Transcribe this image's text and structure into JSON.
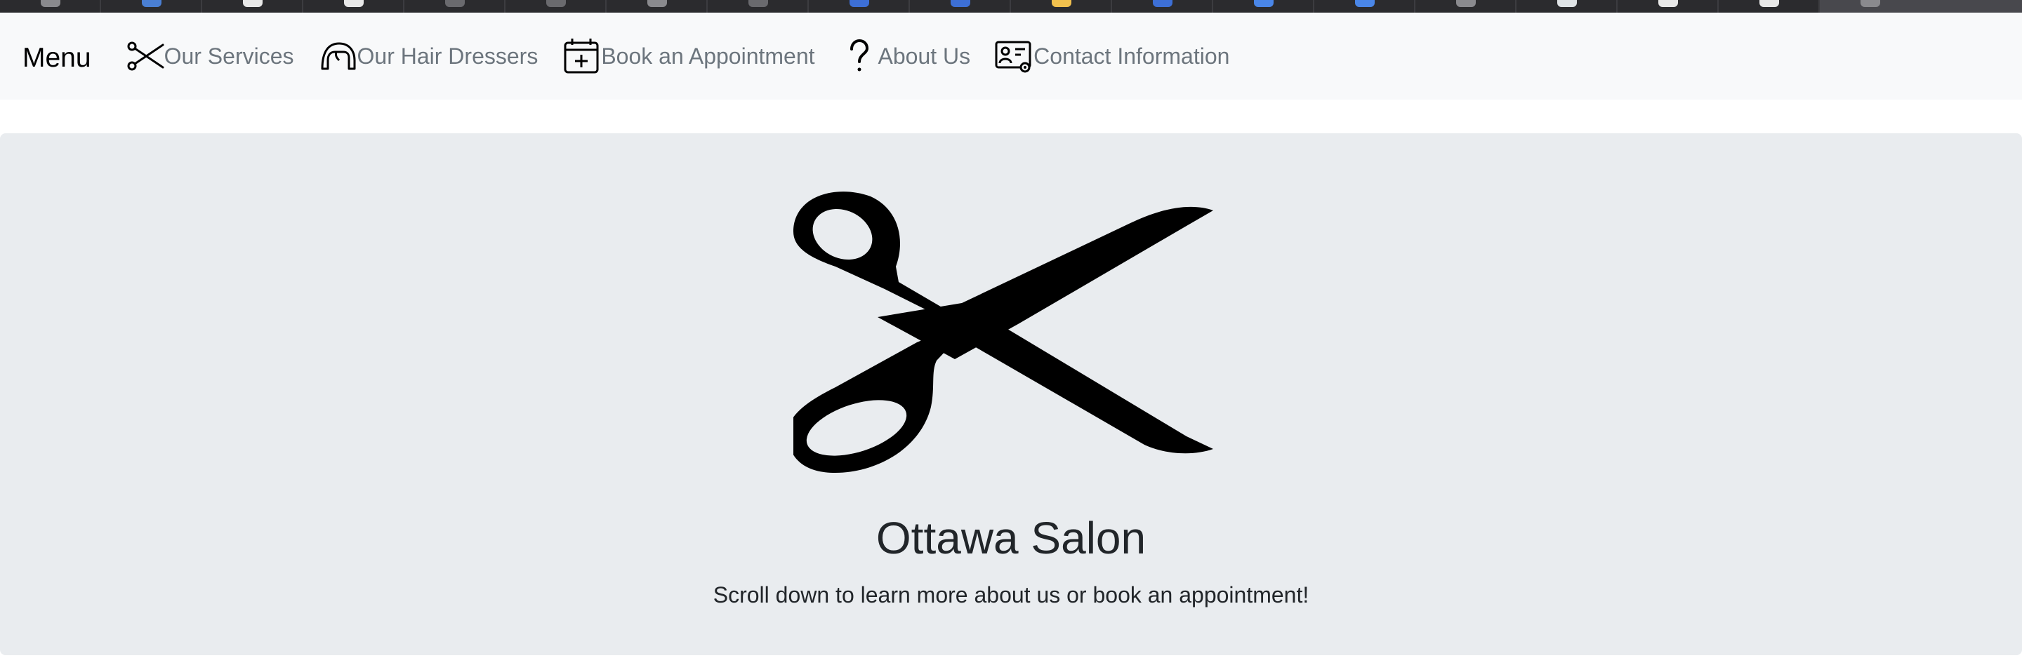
{
  "browser": {
    "tabs": [
      {
        "favicon_color": "#8a8a8e"
      },
      {
        "favicon_color": "#4a7fd4"
      },
      {
        "favicon_color": "#e8e8e8"
      },
      {
        "favicon_color": "#e8e8e8"
      },
      {
        "favicon_color": "#6a6a6e"
      },
      {
        "favicon_color": "#6a6a6e"
      },
      {
        "favicon_color": "#8a8a8e"
      },
      {
        "favicon_color": "#6a6a6e"
      },
      {
        "favicon_color": "#3d6fd6"
      },
      {
        "favicon_color": "#3d6fd6"
      },
      {
        "favicon_color": "#f2c14e"
      },
      {
        "favicon_color": "#3d6fd6"
      },
      {
        "favicon_color": "#4a86e8"
      },
      {
        "favicon_color": "#4a86e8"
      },
      {
        "favicon_color": "#8a8a8e"
      },
      {
        "favicon_color": "#dfe3e6"
      },
      {
        "favicon_color": "#e8e8e8"
      },
      {
        "favicon_color": "#e8e8e8"
      },
      {
        "favicon_color": "#8a8a8e",
        "active": true
      }
    ]
  },
  "navbar": {
    "brand": "Menu",
    "items": [
      {
        "label": "Our Services",
        "icon": "scissors-icon"
      },
      {
        "label": "Our Hair Dressers",
        "icon": "hair-icon"
      },
      {
        "label": "Book an Appointment",
        "icon": "calendar-plus-icon"
      },
      {
        "label": "About Us",
        "icon": "question-icon"
      },
      {
        "label": "Contact Information",
        "icon": "contact-card-icon"
      }
    ]
  },
  "hero": {
    "logo_icon": "scissors-logo",
    "title": "Ottawa Salon",
    "subtitle": "Scroll down to learn more about us or book an appointment!"
  },
  "colors": {
    "navbar_bg": "#f8f9fa",
    "nav_text": "#6c757d",
    "hero_bg": "#e9ecef",
    "heading": "#212529"
  }
}
